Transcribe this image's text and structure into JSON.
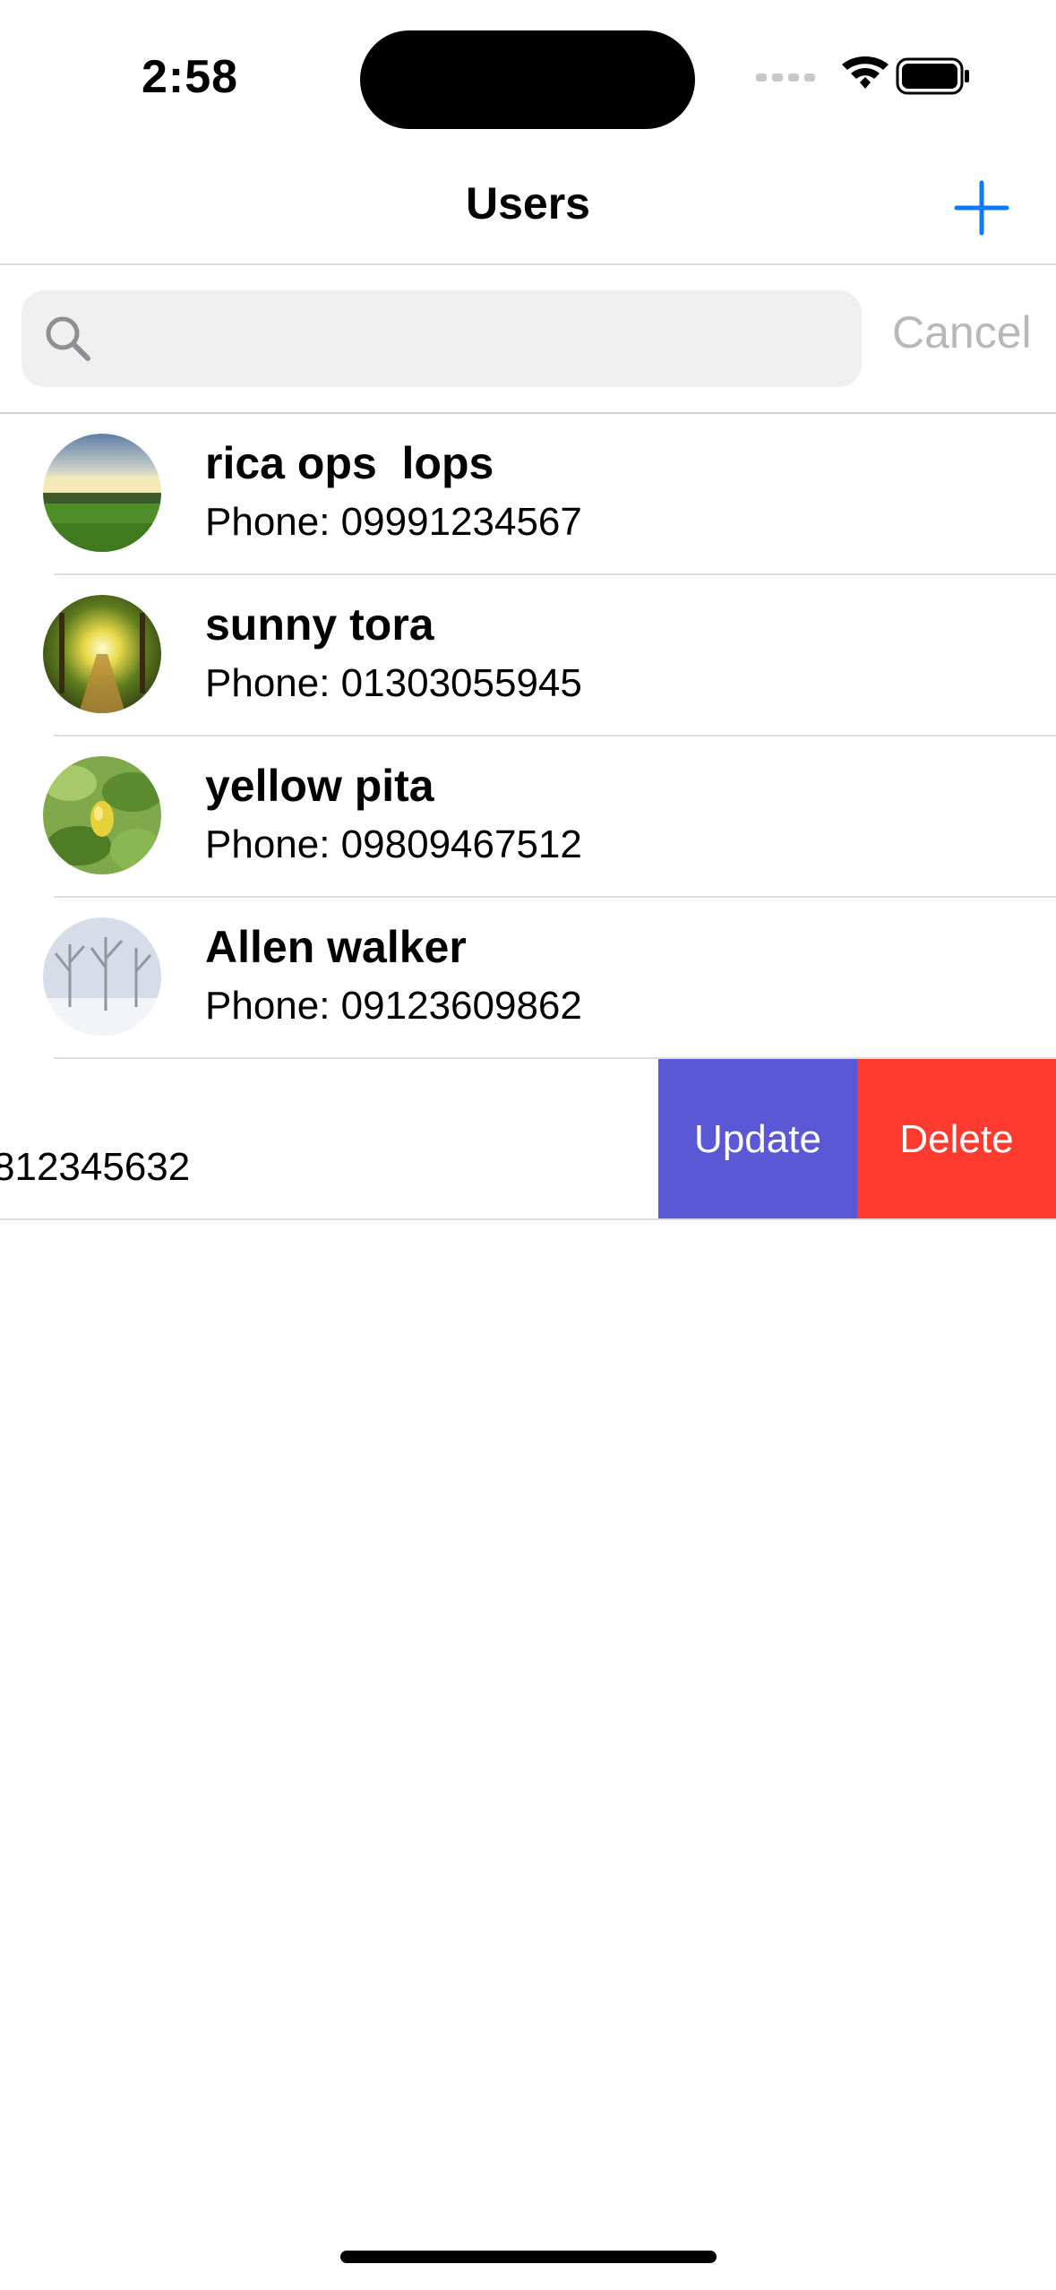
{
  "status_bar": {
    "time": "2:58"
  },
  "nav": {
    "title": "Users",
    "add_icon": "plus-icon"
  },
  "search": {
    "placeholder": "",
    "value": "",
    "cancel_label": "Cancel",
    "icon": "search-icon"
  },
  "users": [
    {
      "name": "rica ops  lops",
      "phone": "Phone: 09991234567",
      "avatar": "meadow-sunset"
    },
    {
      "name": "sunny tora",
      "phone": "Phone: 01303055945",
      "avatar": "forest-path-sun"
    },
    {
      "name": "yellow pita",
      "phone": "Phone: 09809467512",
      "avatar": "lemon-tree"
    },
    {
      "name": "Allen walker",
      "phone": "Phone: 09123609862",
      "avatar": "snowy-trees"
    }
  ],
  "swiped_row": {
    "phone_fragment": "812345632",
    "update_label": "Update",
    "delete_label": "Delete"
  },
  "colors": {
    "accent": "#0a7aff",
    "update": "#5b58d6",
    "delete": "#ff3b30",
    "search_bg": "#efefef"
  }
}
